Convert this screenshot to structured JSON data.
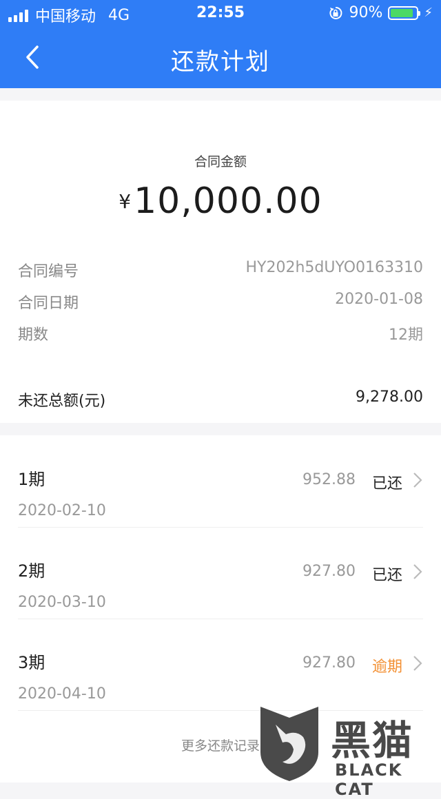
{
  "status_bar": {
    "carrier": "中国移动",
    "network": "4G",
    "time": "22:55",
    "battery_text": "90%",
    "battery_level": 0.9
  },
  "nav": {
    "title": "还款计划"
  },
  "summary": {
    "amount_label": "合同金额",
    "currency_symbol": "¥",
    "amount": "10,000.00",
    "rows": [
      {
        "label": "合同编号",
        "value": "HY202h5dUYO0163310"
      },
      {
        "label": "合同日期",
        "value": "2020-01-08"
      },
      {
        "label": "期数",
        "value": "12期"
      }
    ],
    "outstanding_label": "未还总额(元)",
    "outstanding_value": "9,278.00"
  },
  "installments": [
    {
      "period": "1期",
      "date": "2020-02-10",
      "amount": "952.88",
      "status": "已还"
    },
    {
      "period": "2期",
      "date": "2020-03-10",
      "amount": "927.80",
      "status": "已还"
    },
    {
      "period": "3期",
      "date": "2020-04-10",
      "amount": "927.80",
      "status": "逾期"
    }
  ],
  "more_link": "更多还款记录",
  "colors": {
    "header": "#2f7df6",
    "overdue": "#f39033",
    "battery": "#4cd964"
  },
  "watermark": {
    "cn": "黑猫",
    "en": "BLACK CAT"
  }
}
